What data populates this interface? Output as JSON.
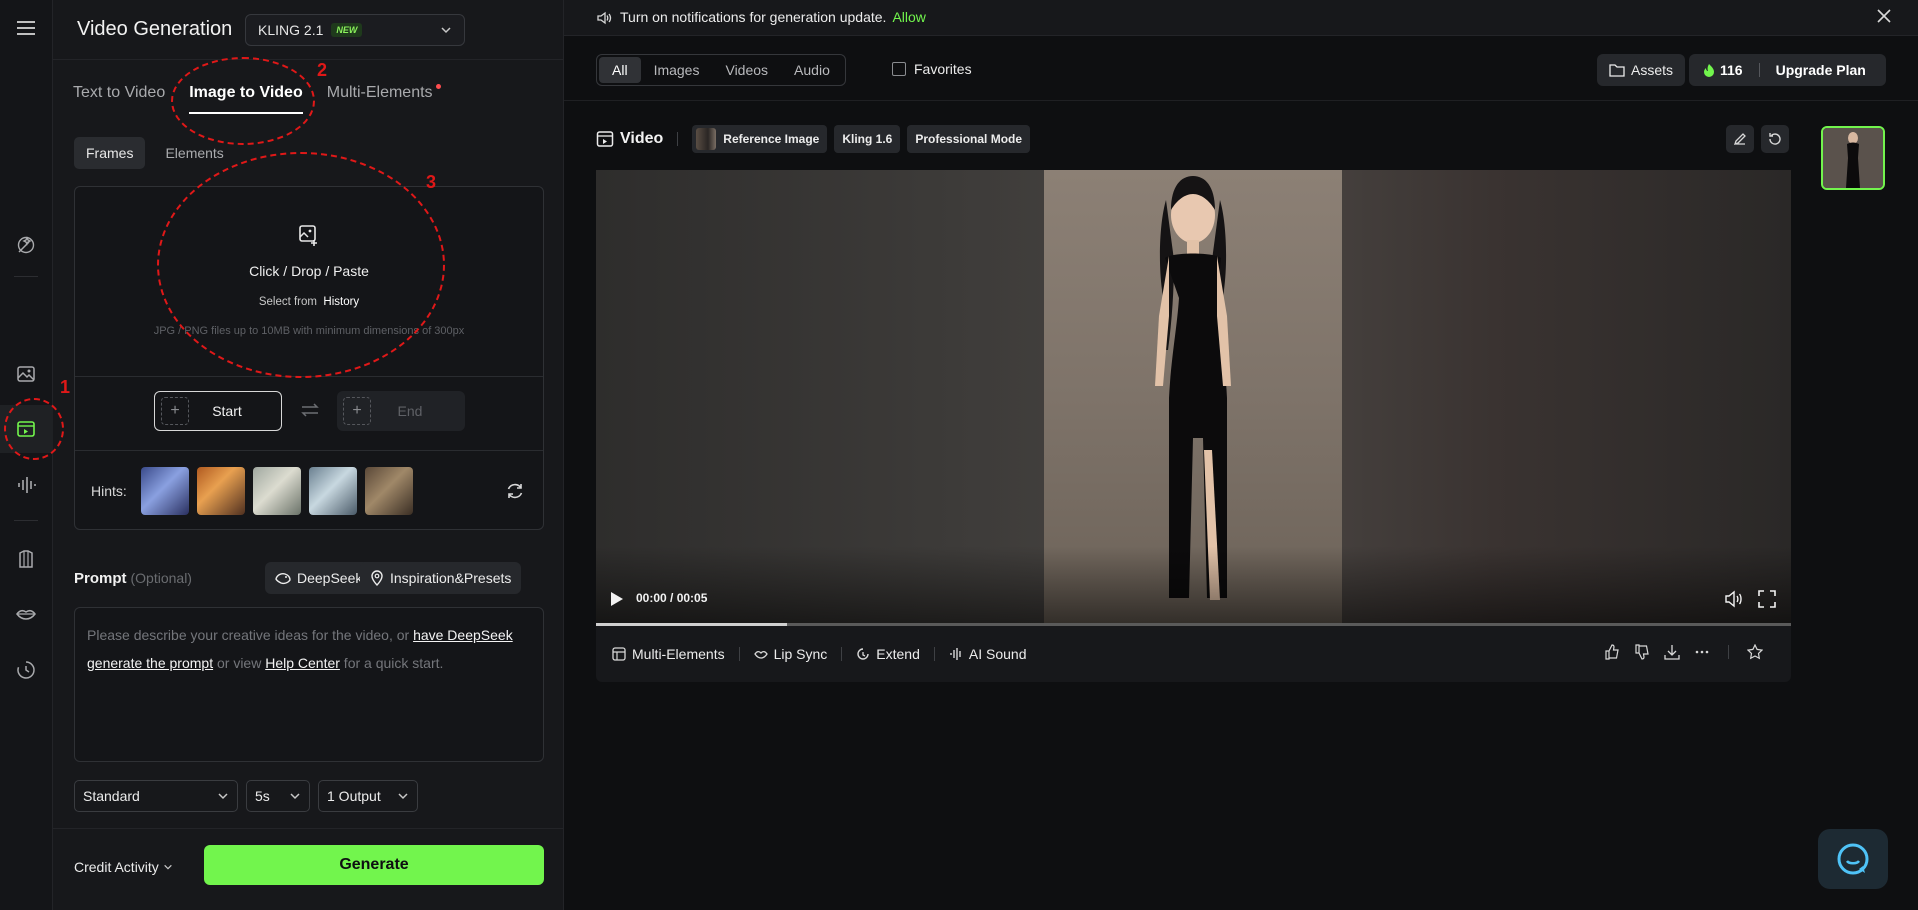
{
  "app": {
    "title": "Video Generation",
    "model": {
      "name": "KLING 2.1",
      "badge": "NEW"
    }
  },
  "rail": {
    "icons": [
      "menu-icon",
      "magic-wand-icon",
      "image-icon",
      "video-icon",
      "audio-wave-icon",
      "shirt-icon",
      "lips-icon",
      "history-icon"
    ]
  },
  "tabs": [
    {
      "label": "Text to Video"
    },
    {
      "label": "Image to Video",
      "active": true
    },
    {
      "label": "Multi-Elements",
      "dot": true
    }
  ],
  "subtabs": [
    {
      "label": "Frames",
      "active": true
    },
    {
      "label": "Elements"
    }
  ],
  "upload": {
    "main": "Click / Drop / Paste",
    "select_prefix": "Select from",
    "select_link": "History",
    "requirements": "JPG / PNG files up to 10MB with minimum dimensions of 300px"
  },
  "frames": {
    "start": "Start",
    "end": "End"
  },
  "hints": {
    "label": "Hints:"
  },
  "prompt": {
    "label": "Prompt",
    "optional": "(Optional)",
    "deepseek": "DeepSeek",
    "inspiration": "Inspiration&Presets",
    "placeholder_1": "Please describe your creative ideas for the video, or ",
    "link_1": "have DeepSeek generate the prompt",
    "placeholder_2": " or view ",
    "link_2": "Help Center",
    "placeholder_3": " for a quick start."
  },
  "settings": {
    "mode": "Standard",
    "duration": "5s",
    "outputs": "1 Output"
  },
  "footer": {
    "credit": "Credit Activity",
    "generate": "Generate"
  },
  "annotations": [
    "1",
    "2",
    "3"
  ],
  "notification": {
    "text": "Turn on notifications for generation update.",
    "allow": "Allow"
  },
  "filters": [
    "All",
    "Images",
    "Videos",
    "Audio"
  ],
  "favorites": "Favorites",
  "assets": "Assets",
  "credits": "116",
  "upgrade": "Upgrade Plan",
  "video": {
    "title": "Video",
    "tags": [
      "Reference Image",
      "Kling 1.6",
      "Professional Mode"
    ],
    "time": "00:00 / 00:05",
    "progress": 0.16
  },
  "actions": [
    "Multi-Elements",
    "Lip Sync",
    "Extend",
    "AI Sound"
  ],
  "colors": {
    "accent": "#72f54d",
    "annotation": "#e01818",
    "background": "#0e0f11"
  }
}
